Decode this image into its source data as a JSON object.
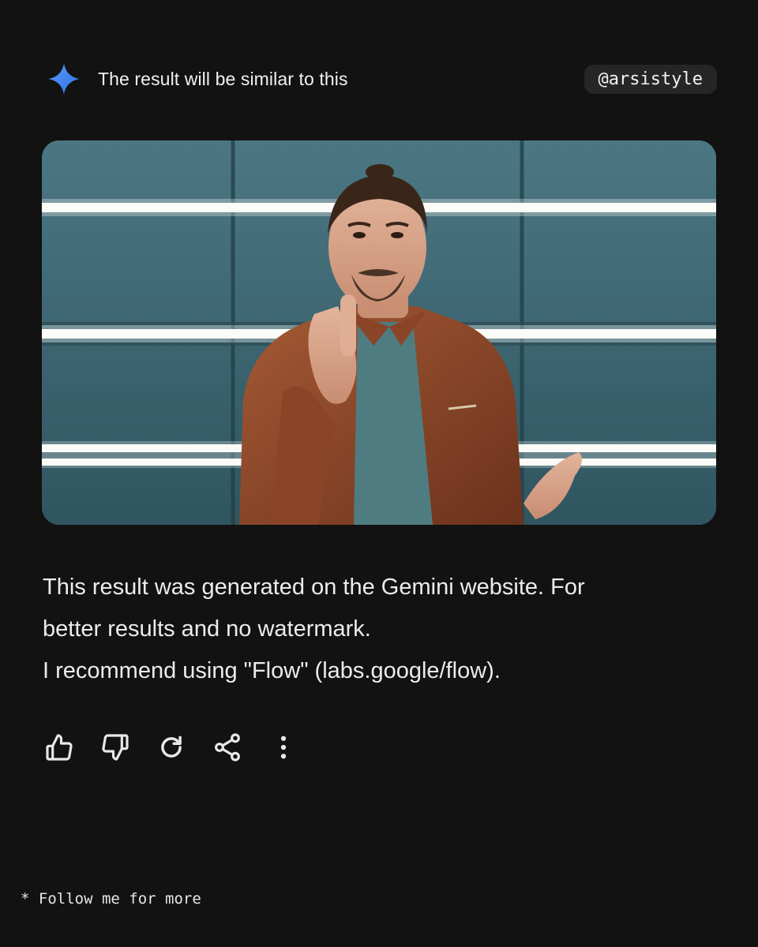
{
  "header": {
    "icon": "gemini-sparkle-icon",
    "title": "The result will be similar to this",
    "handle": "@arsistyle"
  },
  "image": {
    "alt_subject": "photo"
  },
  "response": {
    "line1": "This result was generated on the Gemini website. For",
    "line2": "better results and no watermark.",
    "line3": "I recommend using \"Flow\" (labs.google/flow)."
  },
  "actions": [
    {
      "icon": "thumbs-up-icon"
    },
    {
      "icon": "thumbs-down-icon"
    },
    {
      "icon": "refresh-icon"
    },
    {
      "icon": "share-icon"
    },
    {
      "icon": "more-vert-icon"
    }
  ],
  "footer": {
    "text": "* Follow me for more"
  },
  "colors": {
    "background": "#121212",
    "sparkle": "#4a8bf5",
    "handle_bg": "#262626",
    "panel": "#3f6d78"
  }
}
